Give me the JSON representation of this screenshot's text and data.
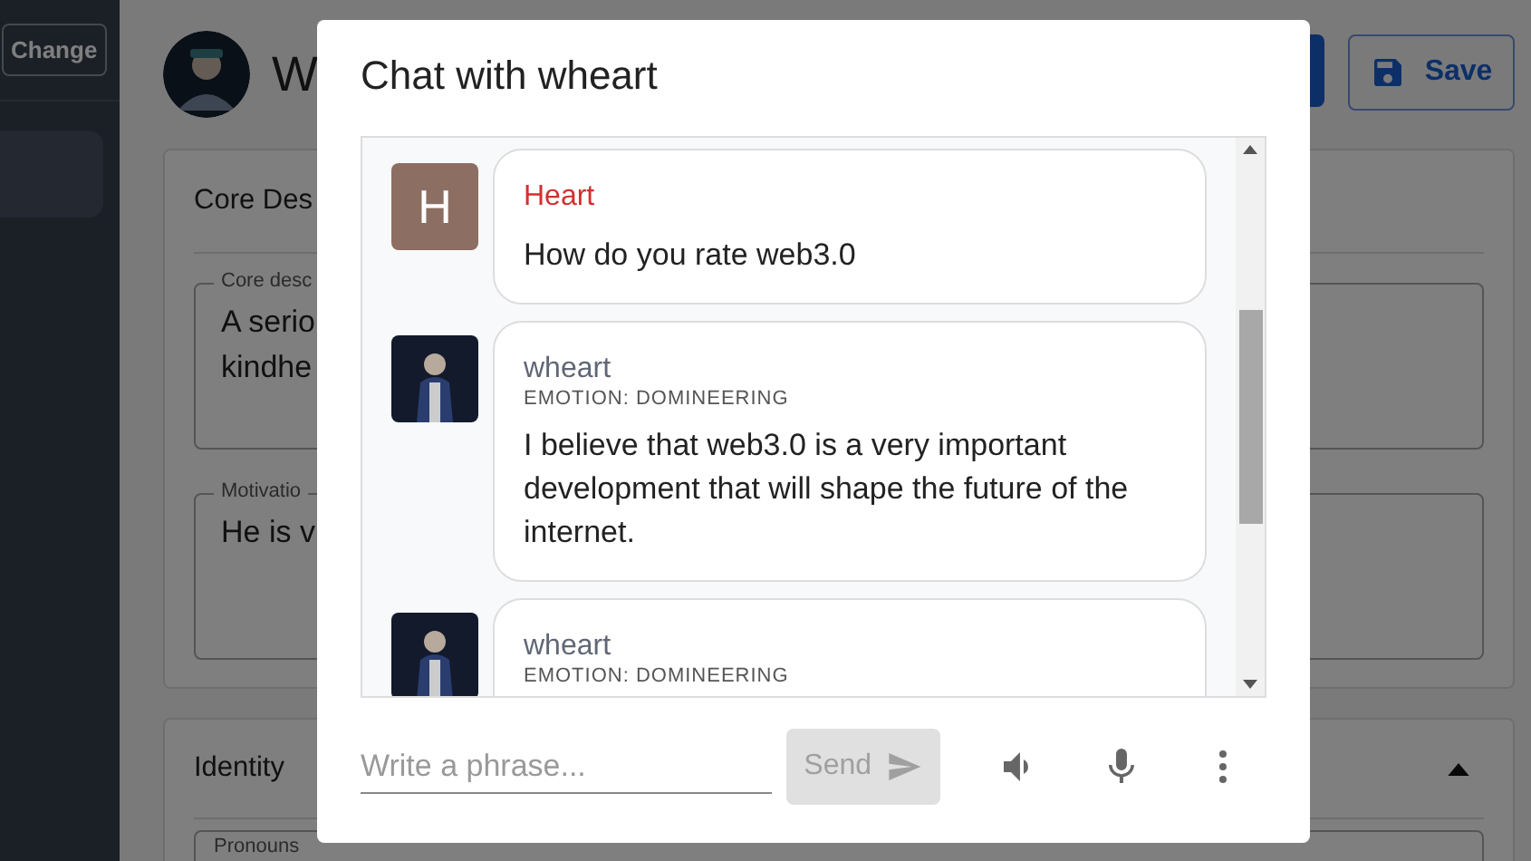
{
  "sidebar": {
    "change_button": "Change"
  },
  "header": {
    "title": "W",
    "save_button": "Save"
  },
  "core_card": {
    "title": "Core Des",
    "fields": [
      {
        "label": "Core desc",
        "lines": [
          "A serio",
          "kindhe"
        ]
      },
      {
        "label": "Motivatio",
        "lines": [
          "He is v"
        ]
      }
    ]
  },
  "identity_card": {
    "title": "Identity",
    "expanded": true,
    "fields": [
      {
        "label": "Pronouns"
      }
    ]
  },
  "chat_dialog": {
    "title": "Chat with wheart",
    "messages": [
      {
        "kind": "user",
        "sender": "Heart",
        "avatar_letter": "H",
        "text": "How do you rate web3.0"
      },
      {
        "kind": "character",
        "sender": "wheart",
        "emotion": "EMOTION: DOMINEERING",
        "text": "I believe that web3.0 is a very important development that will shape the future of the internet."
      },
      {
        "kind": "character",
        "sender": "wheart",
        "emotion": "EMOTION: DOMINEERING"
      }
    ],
    "input": {
      "placeholder": "Write a phrase..."
    },
    "send_button": {
      "label": "Send",
      "disabled": true
    }
  }
}
